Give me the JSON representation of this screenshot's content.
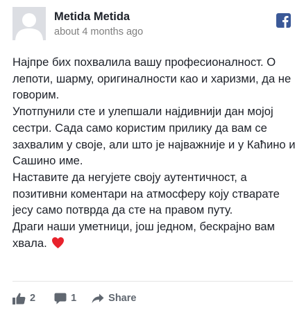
{
  "post": {
    "author": "Metida Metida",
    "timestamp": "about 4 months ago",
    "paragraphs": [
      "Најпре бих похвалила вашу професионалност. О лепоти, шарму, оригиналности као и харизми, да не говорим.",
      "Употпунили сте и улепшали најдивнији дан мојој сестри. Сада само користим прилику да вам се захвалим у своје, али што је најважније и у Каћино и Сашино име.",
      "Наставите да негујете своју аутентичност, а позитивни коментари на атмосферу коју стварате јесу само потврда да сте на правом путу.",
      "Драги наши уметници, још једном, бескрајно вам хвала."
    ],
    "emoji": "heart-emoji"
  },
  "source": {
    "icon": "facebook-icon",
    "color": "#3b5998"
  },
  "actions": {
    "like_icon": "thumbs-up-icon",
    "like_count": "2",
    "comment_icon": "comment-icon",
    "comment_count": "1",
    "share_icon": "share-arrow-icon",
    "share_label": "Share"
  },
  "colors": {
    "text": "#1d2129",
    "muted": "#7f7f7f",
    "action": "#606770",
    "heart": "#e8222c"
  }
}
